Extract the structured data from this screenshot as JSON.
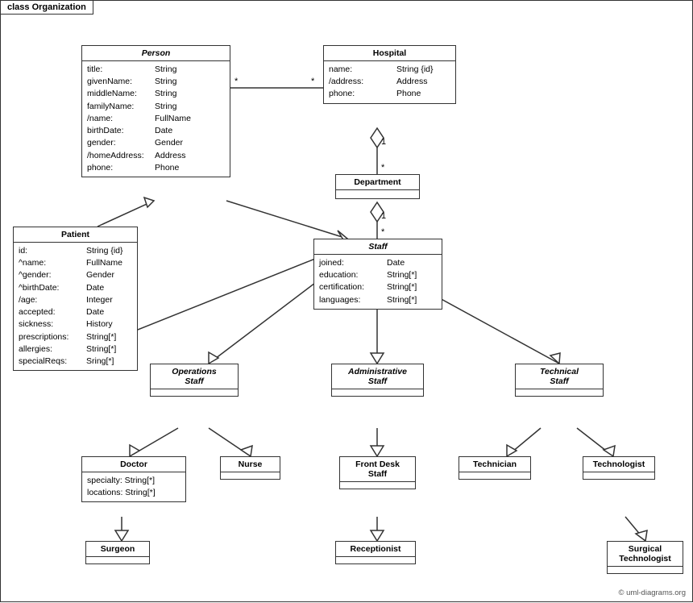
{
  "diagram": {
    "title": "class Organization",
    "copyright": "© uml-diagrams.org",
    "classes": {
      "person": {
        "name": "Person",
        "italic": true,
        "attrs": [
          {
            "name": "title:",
            "type": "String"
          },
          {
            "name": "givenName:",
            "type": "String"
          },
          {
            "name": "middleName:",
            "type": "String"
          },
          {
            "name": "familyName:",
            "type": "String"
          },
          {
            "name": "/name:",
            "type": "FullName"
          },
          {
            "name": "birthDate:",
            "type": "Date"
          },
          {
            "name": "gender:",
            "type": "Gender"
          },
          {
            "name": "/homeAddress:",
            "type": "Address"
          },
          {
            "name": "phone:",
            "type": "Phone"
          }
        ]
      },
      "hospital": {
        "name": "Hospital",
        "attrs": [
          {
            "name": "name:",
            "type": "String {id}"
          },
          {
            "name": "/address:",
            "type": "Address"
          },
          {
            "name": "phone:",
            "type": "Phone"
          }
        ]
      },
      "patient": {
        "name": "Patient",
        "attrs": [
          {
            "name": "id:",
            "type": "String {id}"
          },
          {
            "name": "^name:",
            "type": "FullName"
          },
          {
            "name": "^gender:",
            "type": "Gender"
          },
          {
            "name": "^birthDate:",
            "type": "Date"
          },
          {
            "name": "/age:",
            "type": "Integer"
          },
          {
            "name": "accepted:",
            "type": "Date"
          },
          {
            "name": "sickness:",
            "type": "History"
          },
          {
            "name": "prescriptions:",
            "type": "String[*]"
          },
          {
            "name": "allergies:",
            "type": "String[*]"
          },
          {
            "name": "specialReqs:",
            "type": "Sring[*]"
          }
        ]
      },
      "department": {
        "name": "Department",
        "attrs": []
      },
      "staff": {
        "name": "Staff",
        "italic": true,
        "attrs": [
          {
            "name": "joined:",
            "type": "Date"
          },
          {
            "name": "education:",
            "type": "String[*]"
          },
          {
            "name": "certification:",
            "type": "String[*]"
          },
          {
            "name": "languages:",
            "type": "String[*]"
          }
        ]
      },
      "operations_staff": {
        "name": "Operations Staff",
        "italic": true,
        "attrs": []
      },
      "administrative_staff": {
        "name": "Administrative Staff",
        "italic": true,
        "attrs": []
      },
      "technical_staff": {
        "name": "Technical Staff",
        "italic": true,
        "attrs": []
      },
      "doctor": {
        "name": "Doctor",
        "attrs": [
          {
            "name": "specialty:",
            "type": "String[*]"
          },
          {
            "name": "locations:",
            "type": "String[*]"
          }
        ]
      },
      "nurse": {
        "name": "Nurse",
        "attrs": []
      },
      "front_desk_staff": {
        "name": "Front Desk Staff",
        "attrs": []
      },
      "technician": {
        "name": "Technician",
        "attrs": []
      },
      "technologist": {
        "name": "Technologist",
        "attrs": []
      },
      "surgeon": {
        "name": "Surgeon",
        "attrs": []
      },
      "receptionist": {
        "name": "Receptionist",
        "attrs": []
      },
      "surgical_technologist": {
        "name": "Surgical Technologist",
        "attrs": []
      }
    }
  }
}
